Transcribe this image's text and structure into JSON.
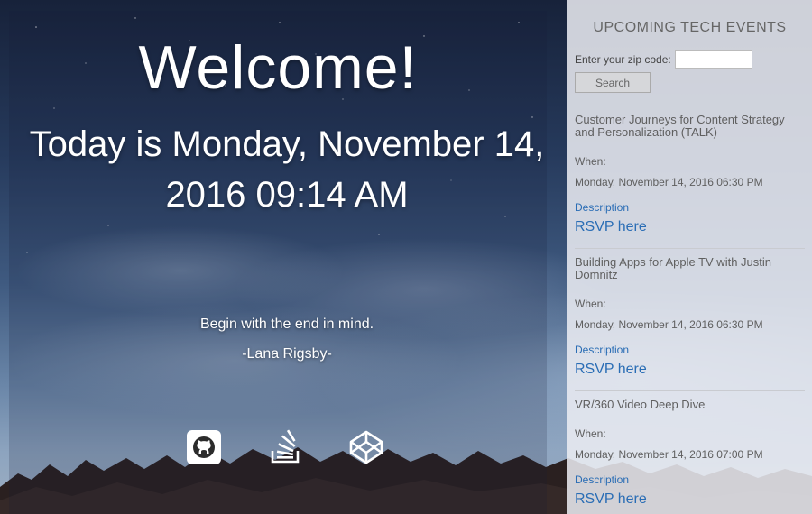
{
  "main": {
    "welcome": "Welcome!",
    "date_line": "Today is Monday, November 14, 2016 09:14 AM",
    "quote": "Begin with the end in mind.",
    "author": "-Lana Rigsby-",
    "social_icons": [
      "github-icon",
      "stackoverflow-icon",
      "codepen-icon"
    ]
  },
  "sidebar": {
    "title": "UPCOMING TECH EVENTS",
    "zip_label": "Enter your zip code:",
    "zip_value": "",
    "search_label": "Search",
    "events": [
      {
        "title": "Customer Journeys for Content Strategy and Personalization (TALK)",
        "when_label": "When:",
        "time": "Monday, November 14, 2016 06:30 PM",
        "description_label": "Description",
        "rsvp_label": "RSVP here"
      },
      {
        "title": "Building Apps for Apple TV with Justin Domnitz",
        "when_label": "When:",
        "time": "Monday, November 14, 2016 06:30 PM",
        "description_label": "Description",
        "rsvp_label": "RSVP here"
      },
      {
        "title": "VR/360 Video Deep Dive",
        "when_label": "When:",
        "time": "Monday, November 14, 2016 07:00 PM",
        "description_label": "Description",
        "rsvp_label": "RSVP here"
      }
    ]
  },
  "colors": {
    "link": "#2a6db5",
    "panel_bg": "#eceef3",
    "text_light": "#ffffff"
  }
}
